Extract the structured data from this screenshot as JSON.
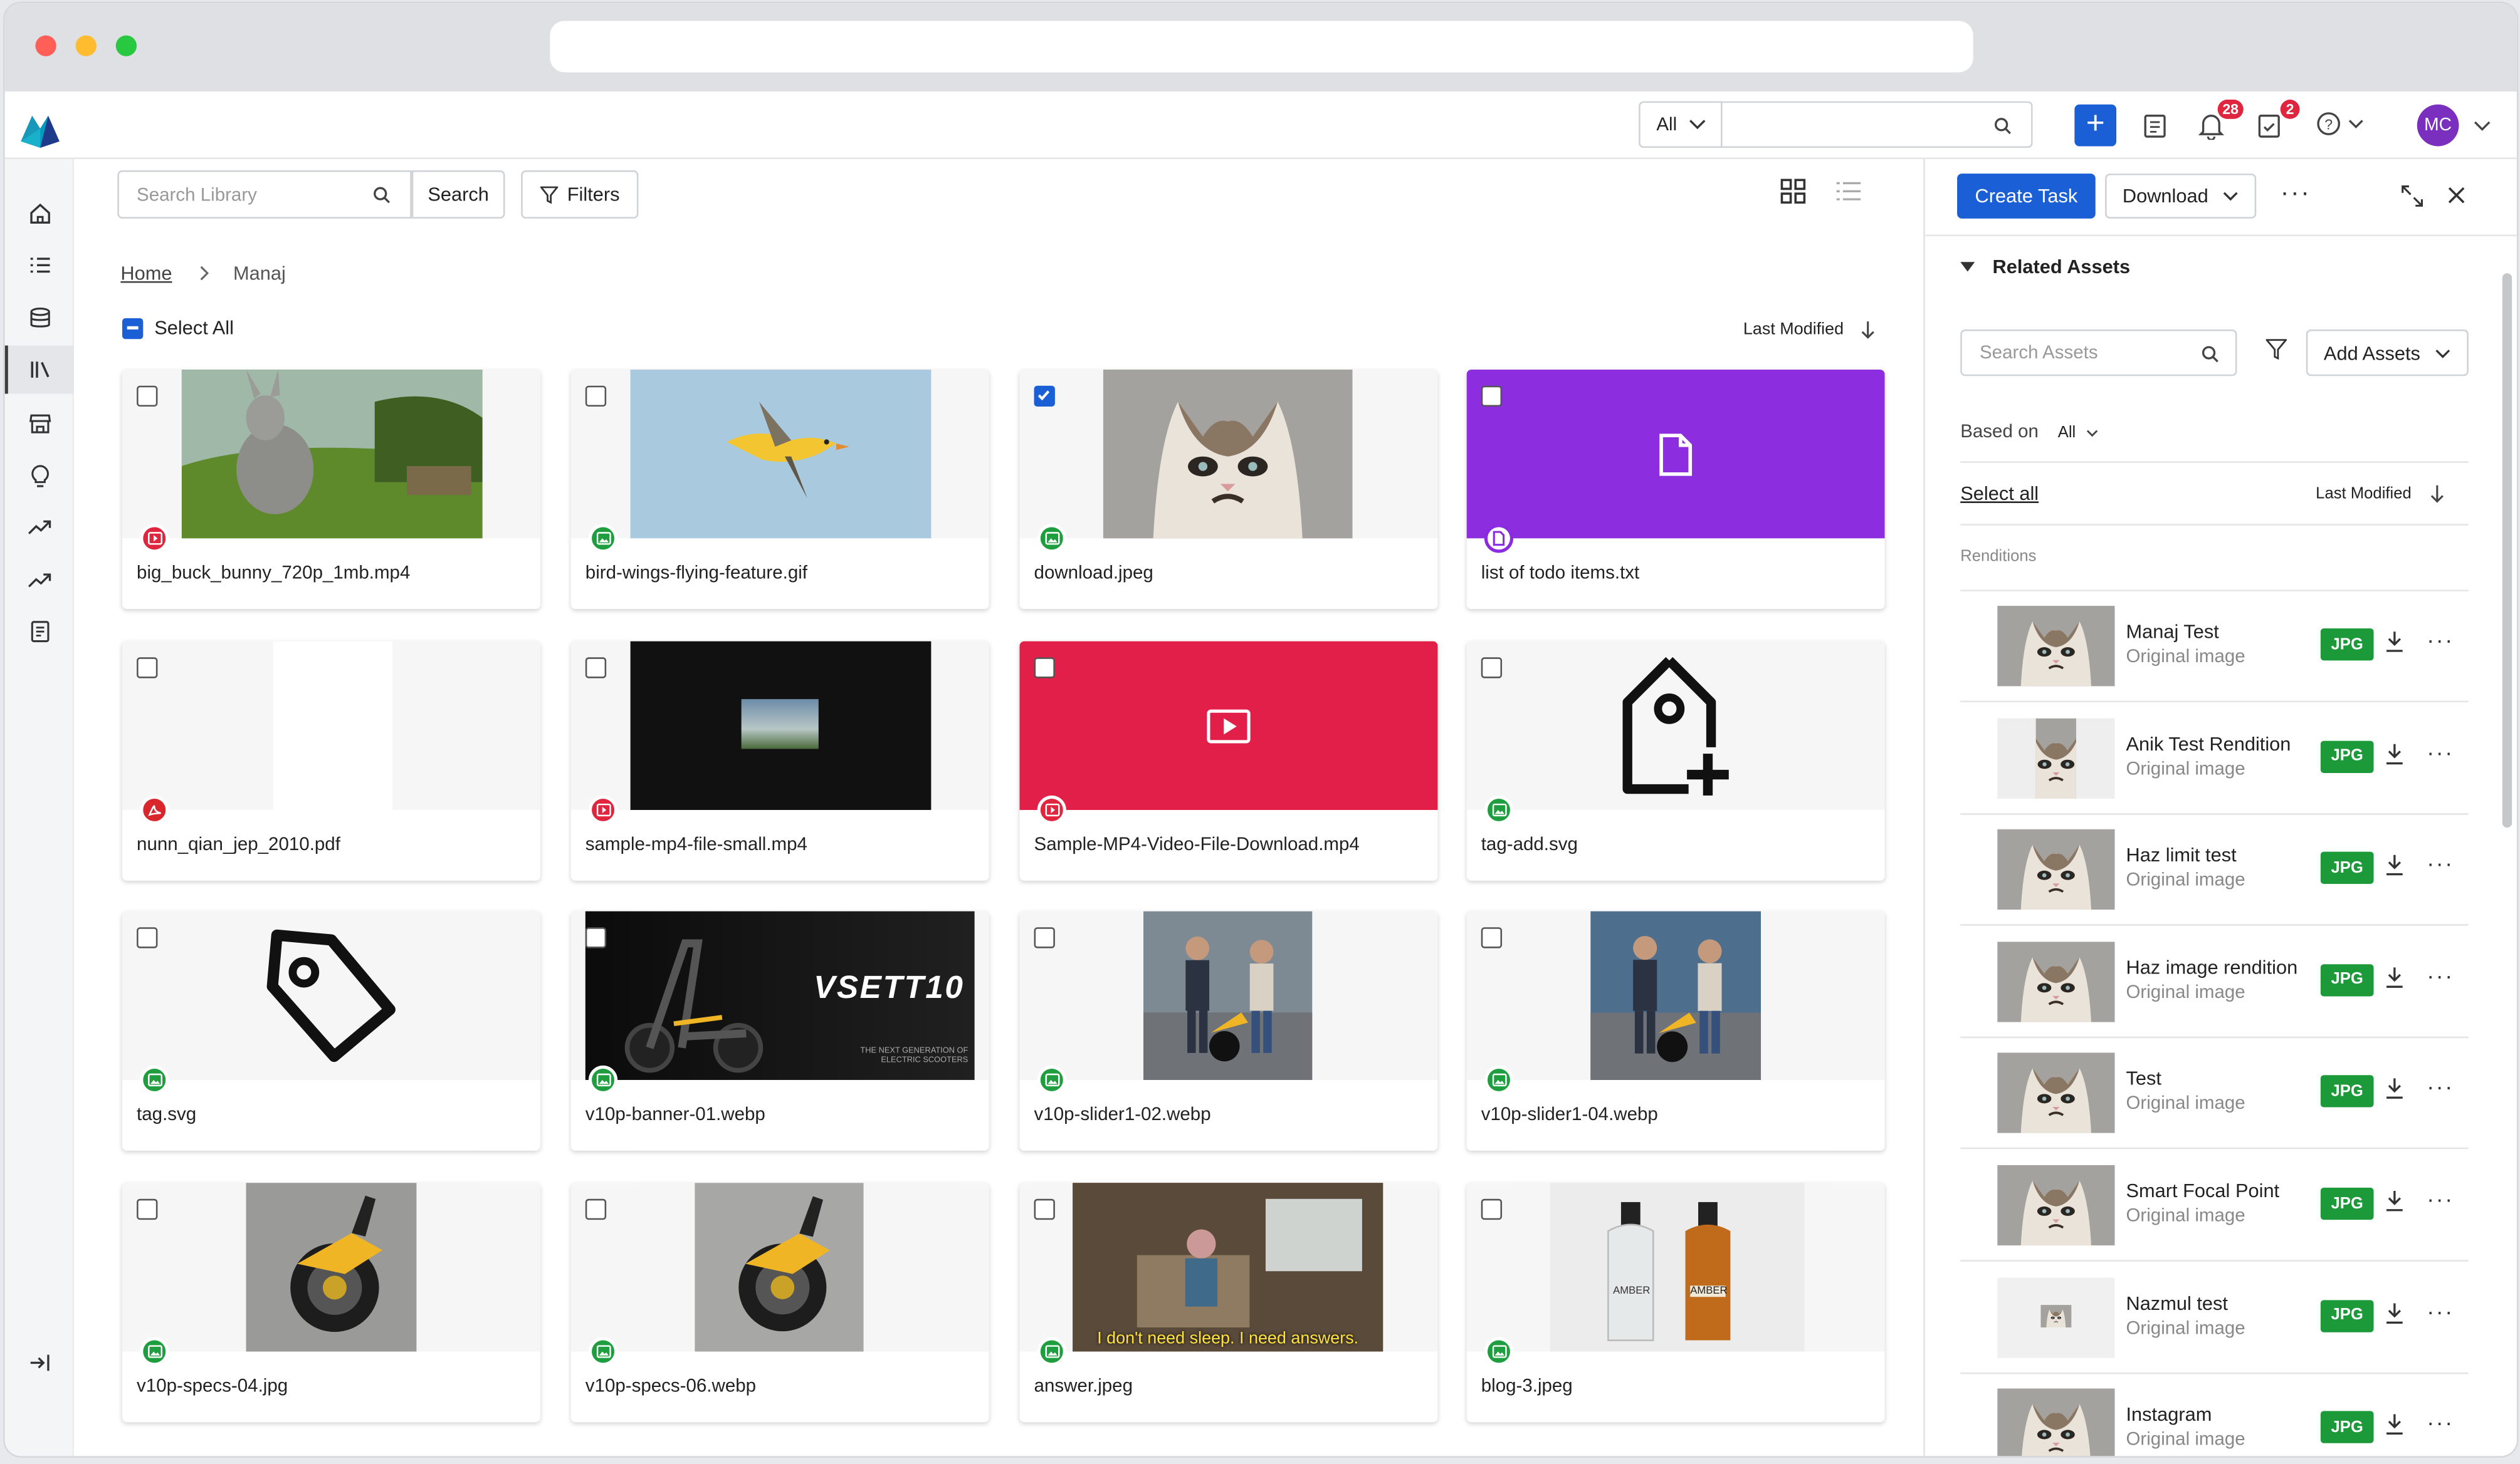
{
  "topbar": {
    "scope_label": "All",
    "notifications_count": "28",
    "tasks_count": "2",
    "avatar_initials": "MC"
  },
  "toolbar": {
    "search_placeholder": "Search Library",
    "search_button": "Search",
    "filters_button": "Filters"
  },
  "breadcrumb": {
    "home": "Home",
    "current": "Manaj"
  },
  "library": {
    "select_all": "Select All",
    "sort_label": "Last Modified"
  },
  "assets": [
    {
      "name": "big_buck_bunny_720p_1mb.mp4",
      "type": "video",
      "checked": false
    },
    {
      "name": "bird-wings-flying-feature.gif",
      "type": "image",
      "checked": false
    },
    {
      "name": "download.jpeg",
      "type": "image",
      "checked": true
    },
    {
      "name": "list of todo items.txt",
      "type": "document",
      "checked": false
    },
    {
      "name": "nunn_qian_jep_2010.pdf",
      "type": "pdf",
      "checked": false
    },
    {
      "name": "sample-mp4-file-small.mp4",
      "type": "video",
      "checked": false
    },
    {
      "name": "Sample-MP4-Video-File-Download.mp4",
      "type": "video",
      "checked": false
    },
    {
      "name": "tag-add.svg",
      "type": "image",
      "checked": false
    },
    {
      "name": "tag.svg",
      "type": "image",
      "checked": false
    },
    {
      "name": "v10p-banner-01.webp",
      "type": "image",
      "checked": false
    },
    {
      "name": "v10p-slider1-02.webp",
      "type": "image",
      "checked": false
    },
    {
      "name": "v10p-slider1-04.webp",
      "type": "image",
      "checked": false
    },
    {
      "name": "v10p-specs-04.jpg",
      "type": "image",
      "checked": false
    },
    {
      "name": "v10p-specs-06.webp",
      "type": "image",
      "checked": false
    },
    {
      "name": "answer.jpeg",
      "type": "image",
      "checked": false
    },
    {
      "name": "blog-3.jpeg",
      "type": "image",
      "checked": false
    }
  ],
  "thumb_text": {
    "banner_brand": "VSETT10",
    "banner_tagline_1": "THE NEXT GENERATION OF",
    "banner_tagline_2": "ELECTRIC SCOOTERS",
    "answer_caption": "I don't need sleep. I need answers.",
    "bottle_label": "AMBER"
  },
  "panel": {
    "create_task": "Create Task",
    "download": "Download",
    "related_title": "Related Assets",
    "search_placeholder": "Search Assets",
    "add_assets": "Add Assets",
    "based_on_label": "Based on",
    "based_on_value": "All",
    "select_all": "Select all",
    "sort_label": "Last Modified",
    "renditions_label": "Renditions",
    "renditions": [
      {
        "name": "Manaj Test",
        "sub": "Original image",
        "format": "JPG"
      },
      {
        "name": "Anik Test Rendition",
        "sub": "Original image",
        "format": "JPG"
      },
      {
        "name": "Haz limit test",
        "sub": "Original image",
        "format": "JPG"
      },
      {
        "name": "Haz image rendition",
        "sub": "Original image",
        "format": "JPG"
      },
      {
        "name": "Test",
        "sub": "Original image",
        "format": "JPG"
      },
      {
        "name": "Smart Focal Point",
        "sub": "Original image",
        "format": "JPG"
      },
      {
        "name": "Nazmul test",
        "sub": "Original image",
        "format": "JPG"
      },
      {
        "name": "Instagram",
        "sub": "Original image",
        "format": "JPG"
      }
    ]
  },
  "colors": {
    "accent": "#1a5fd6",
    "image_badge": "#1e9e3e",
    "video_badge": "#e0263f",
    "avatar": "#7b2fbe"
  },
  "icons": [
    "home-icon",
    "list-icon",
    "database-icon",
    "library-icon",
    "store-icon",
    "lightbulb-icon",
    "trend-icon",
    "trend-icon",
    "report-icon",
    "collapse-icon"
  ]
}
